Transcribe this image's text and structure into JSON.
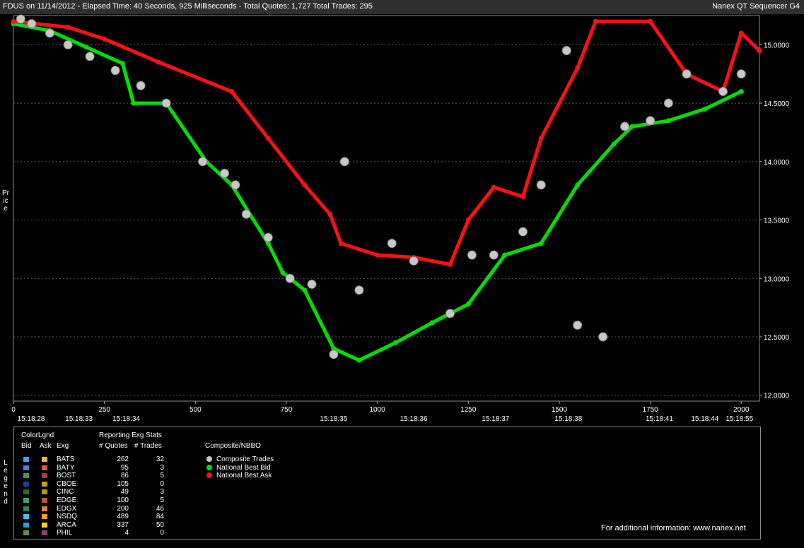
{
  "header": {
    "left": "FDUS on 11/14/2012  -  Elapsed Time: 40 Seconds, 925 Milliseconds  -  Total Quotes: 1,727  Total Trades: 295",
    "right": "Nanex QT Sequencer G4"
  },
  "chart_data": {
    "type": "line",
    "ylabel": "Price",
    "ylim": [
      11.95,
      15.25
    ],
    "xlim": [
      0,
      2050
    ],
    "yticks": [
      "15.0000",
      "14.5000",
      "14.0000",
      "13.5000",
      "13.0000",
      "12.5000",
      "12.0000"
    ],
    "ytick_values": [
      15.0,
      14.5,
      14.0,
      13.5,
      13.0,
      12.5,
      12.0
    ],
    "xticks": [
      "0",
      "250",
      "500",
      "750",
      "1000",
      "1250",
      "1500",
      "1750",
      "2000"
    ],
    "xtick_values": [
      0,
      250,
      500,
      750,
      1000,
      1250,
      1500,
      1750,
      2000
    ],
    "time_labels": [
      {
        "x": 0,
        "label": "15:18:28"
      },
      {
        "x": 180,
        "label": "15:18:33"
      },
      {
        "x": 310,
        "label": "15:18:34"
      },
      {
        "x": 880,
        "label": "15:18:35"
      },
      {
        "x": 1100,
        "label": "15:18:36"
      },
      {
        "x": 1325,
        "label": "15:18:37"
      },
      {
        "x": 1525,
        "label": "15:18:38"
      },
      {
        "x": 1775,
        "label": "15:18:41"
      },
      {
        "x": 1900,
        "label": "15:18:44"
      },
      {
        "x": 1995,
        "label": "15:18:55"
      }
    ],
    "grid": true,
    "series": [
      {
        "name": "National Best Bid",
        "color": "#00e000",
        "points": [
          [
            0,
            15.18
          ],
          [
            100,
            15.12
          ],
          [
            200,
            14.98
          ],
          [
            300,
            14.84
          ],
          [
            330,
            14.5
          ],
          [
            420,
            14.5
          ],
          [
            530,
            14.0
          ],
          [
            600,
            13.8
          ],
          [
            700,
            13.3
          ],
          [
            740,
            13.05
          ],
          [
            800,
            12.9
          ],
          [
            880,
            12.4
          ],
          [
            950,
            12.3
          ],
          [
            1050,
            12.45
          ],
          [
            1150,
            12.62
          ],
          [
            1250,
            12.78
          ],
          [
            1350,
            13.2
          ],
          [
            1450,
            13.3
          ],
          [
            1550,
            13.8
          ],
          [
            1650,
            14.15
          ],
          [
            1700,
            14.3
          ],
          [
            1800,
            14.35
          ],
          [
            1900,
            14.45
          ],
          [
            2000,
            14.6
          ]
        ]
      },
      {
        "name": "National Best Ask",
        "color": "#ff1010",
        "points": [
          [
            0,
            15.2
          ],
          [
            150,
            15.15
          ],
          [
            250,
            15.05
          ],
          [
            400,
            14.85
          ],
          [
            600,
            14.6
          ],
          [
            700,
            14.2
          ],
          [
            800,
            13.8
          ],
          [
            870,
            13.55
          ],
          [
            900,
            13.3
          ],
          [
            1000,
            13.2
          ],
          [
            1100,
            13.18
          ],
          [
            1200,
            13.12
          ],
          [
            1250,
            13.5
          ],
          [
            1320,
            13.78
          ],
          [
            1400,
            13.7
          ],
          [
            1450,
            14.2
          ],
          [
            1550,
            14.8
          ],
          [
            1600,
            15.2
          ],
          [
            1750,
            15.2
          ],
          [
            1850,
            14.75
          ],
          [
            1950,
            14.6
          ],
          [
            2000,
            15.1
          ],
          [
            2050,
            14.95
          ]
        ]
      },
      {
        "name": "Composite Trades",
        "color": "#c8c8c8",
        "points": [
          [
            20,
            15.22
          ],
          [
            50,
            15.18
          ],
          [
            100,
            15.1
          ],
          [
            150,
            15.0
          ],
          [
            210,
            14.9
          ],
          [
            280,
            14.78
          ],
          [
            350,
            14.65
          ],
          [
            420,
            14.5
          ],
          [
            520,
            14.0
          ],
          [
            580,
            13.9
          ],
          [
            610,
            13.8
          ],
          [
            640,
            13.55
          ],
          [
            700,
            13.35
          ],
          [
            760,
            13.0
          ],
          [
            820,
            12.95
          ],
          [
            880,
            12.35
          ],
          [
            910,
            14.0
          ],
          [
            950,
            12.9
          ],
          [
            1040,
            13.3
          ],
          [
            1100,
            13.15
          ],
          [
            1200,
            12.7
          ],
          [
            1260,
            13.2
          ],
          [
            1320,
            13.2
          ],
          [
            1400,
            13.4
          ],
          [
            1450,
            13.8
          ],
          [
            1520,
            14.95
          ],
          [
            1550,
            12.6
          ],
          [
            1620,
            12.5
          ],
          [
            1680,
            14.3
          ],
          [
            1750,
            14.35
          ],
          [
            1800,
            14.5
          ],
          [
            1850,
            14.75
          ],
          [
            1950,
            14.6
          ],
          [
            2000,
            14.75
          ]
        ]
      }
    ]
  },
  "legend": {
    "side_label": "Legend",
    "header_colorlgnd": "ColorLgnd",
    "header_bid": "Bid",
    "header_ask": "Ask",
    "header_exg": "Exg",
    "header_stats": "Reporting Exg Stats",
    "header_quotes": "# Quotes",
    "header_trades": "# Trades",
    "header_composite": "Composite/NBBO",
    "exchanges": [
      {
        "name": "BATS",
        "quotes": "262",
        "trades": "32",
        "bid_color": "#3aa0ff",
        "ask_color": "#f0b040"
      },
      {
        "name": "BATY",
        "quotes": "95",
        "trades": "3",
        "bid_color": "#5a7ad8",
        "ask_color": "#d06030"
      },
      {
        "name": "BOST",
        "quotes": "86",
        "trades": "5",
        "bid_color": "#3c9a6a",
        "ask_color": "#a04040"
      },
      {
        "name": "CBOE",
        "quotes": "105",
        "trades": "0",
        "bid_color": "#1f3fa0",
        "ask_color": "#c8a020"
      },
      {
        "name": "CINC",
        "quotes": "49",
        "trades": "3",
        "bid_color": "#2a6a30",
        "ask_color": "#b09020"
      },
      {
        "name": "EDGE",
        "quotes": "100",
        "trades": "5",
        "bid_color": "#4aa060",
        "ask_color": "#c05830"
      },
      {
        "name": "EDGX",
        "quotes": "200",
        "trades": "46",
        "bid_color": "#3a7a60",
        "ask_color": "#e08040"
      },
      {
        "name": "NSDQ",
        "quotes": "489",
        "trades": "84",
        "bid_color": "#40c0f0",
        "ask_color": "#f0a020"
      },
      {
        "name": "ARCA",
        "quotes": "337",
        "trades": "50",
        "bid_color": "#20a0e0",
        "ask_color": "#ffd020"
      },
      {
        "name": "PHIL",
        "quotes": "4",
        "trades": "0",
        "bid_color": "#609040",
        "ask_color": "#904070"
      }
    ],
    "composite_items": [
      {
        "label": "Composite Trades",
        "color": "#c8c8c8"
      },
      {
        "label": "National Best Bid",
        "color": "#00e000"
      },
      {
        "label": "National Best Ask",
        "color": "#ff1010"
      }
    ]
  },
  "footer": {
    "info": "For additional information: www.nanex.net"
  }
}
